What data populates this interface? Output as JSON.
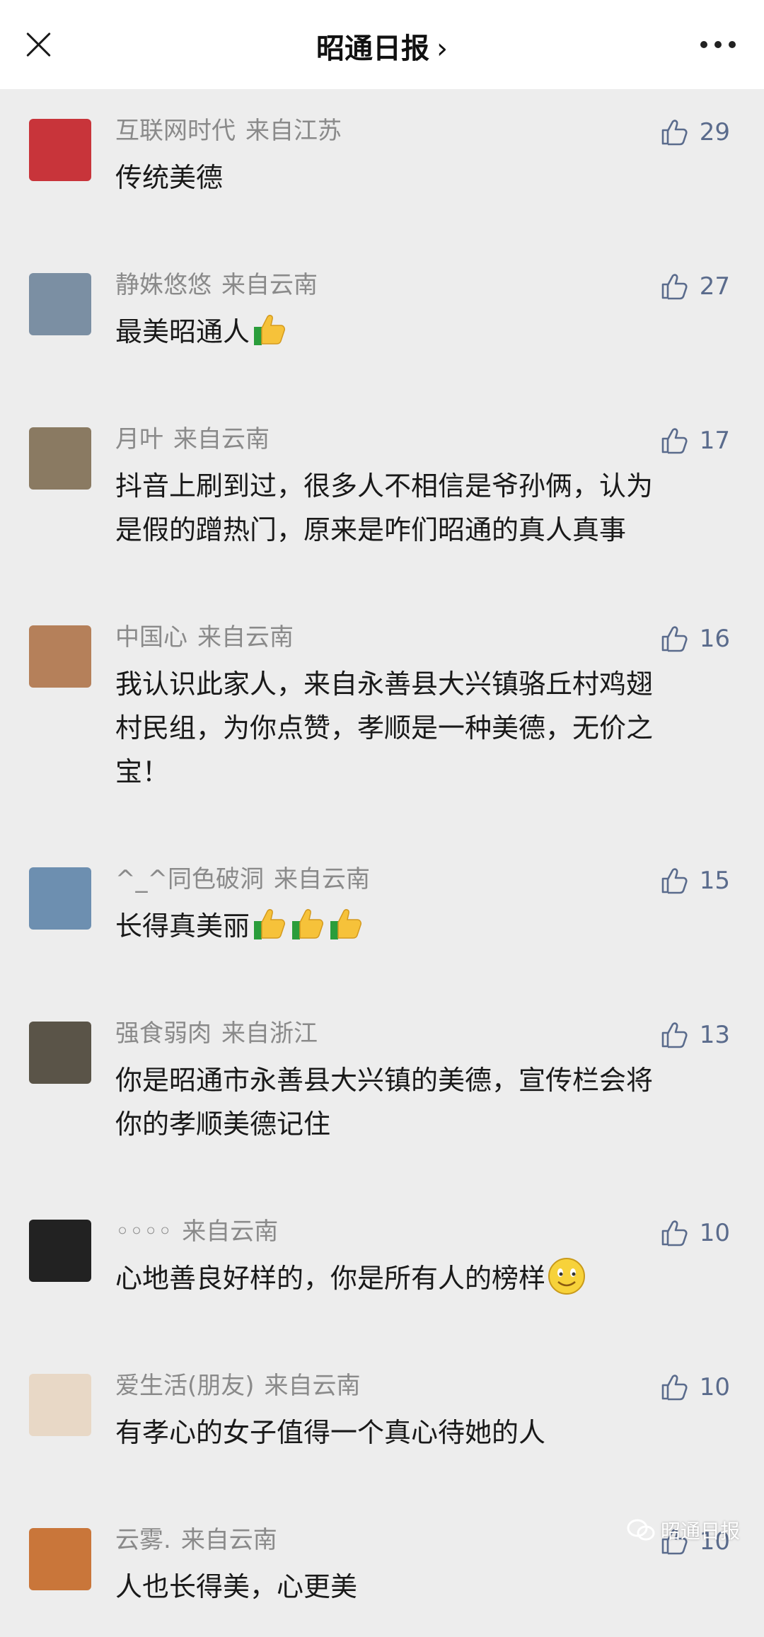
{
  "header": {
    "title": "昭通日报",
    "chevron": "›"
  },
  "comments": [
    {
      "name": "互联网时代",
      "location": "来自江苏",
      "likes": "29",
      "text": "传统美德",
      "thumbs": 0,
      "smile": false,
      "avatar_color": "#c8343a"
    },
    {
      "name": "静姝悠悠",
      "location": "来自云南",
      "likes": "27",
      "text": "最美昭通人",
      "thumbs": 1,
      "smile": false,
      "avatar_color": "#7b8fa3"
    },
    {
      "name": "月叶",
      "location": "来自云南",
      "likes": "17",
      "text": "抖音上刷到过，很多人不相信是爷孙俩，认为是假的蹭热门，原来是咋们昭通的真人真事",
      "thumbs": 0,
      "smile": false,
      "avatar_color": "#8a7a62"
    },
    {
      "name": "中国心",
      "location": "来自云南",
      "likes": "16",
      "text": "我认识此家人，来自永善县大兴镇骆丘村鸡翅村民组，为你点赞，孝顺是一种美德，无价之宝！",
      "thumbs": 0,
      "smile": false,
      "avatar_color": "#b5805a"
    },
    {
      "name": "^_^同色破洞",
      "location": "来自云南",
      "likes": "15",
      "text": "长得真美丽",
      "thumbs": 3,
      "smile": false,
      "avatar_color": "#6d8fb0"
    },
    {
      "name": "强食弱肉",
      "location": "来自浙江",
      "likes": "13",
      "text": "你是昭通市永善县大兴镇的美德，宣传栏会将你的孝顺美德记住",
      "thumbs": 0,
      "smile": false,
      "avatar_color": "#5a5448"
    },
    {
      "name": "◦◦◦◦",
      "location": "来自云南",
      "likes": "10",
      "text": "心地善良好样的，你是所有人的榜样",
      "thumbs": 0,
      "smile": true,
      "avatar_color": "#222222"
    },
    {
      "name": "爱生活(朋友)",
      "location": "来自云南",
      "likes": "10",
      "text": "有孝心的女子值得一个真心待她的人",
      "thumbs": 0,
      "smile": false,
      "avatar_color": "#e8d8c6"
    },
    {
      "name": "云雾.",
      "location": "来自云南",
      "likes": "10",
      "text": "人也长得美，心更美",
      "thumbs": 0,
      "smile": false,
      "avatar_color": "#c9763a"
    }
  ],
  "watermark": "昭通日报"
}
